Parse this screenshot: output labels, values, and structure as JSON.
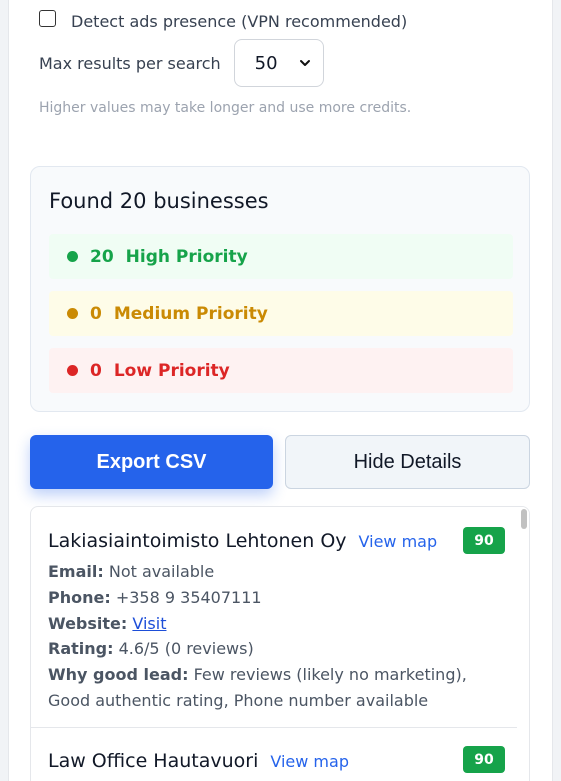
{
  "settings": {
    "detect_ads_label": "Detect ads presence (VPN recommended)",
    "detect_ads_checked": false,
    "max_results_label": "Max results per search",
    "max_results_value": "50",
    "hint": "Higher values may take longer and use more credits."
  },
  "summary": {
    "title": "Found 20 businesses",
    "high": {
      "count": "20",
      "label": "High Priority",
      "color": "#16a34a"
    },
    "medium": {
      "count": "0",
      "label": "Medium Priority",
      "color": "#ca8a04"
    },
    "low": {
      "count": "0",
      "label": "Low Priority",
      "color": "#dc2626"
    }
  },
  "actions": {
    "export_label": "Export CSV",
    "hide_label": "Hide Details"
  },
  "results": [
    {
      "name": "Lakiasiaintoimisto Lehtonen Oy",
      "view_map": "View map",
      "score": "90",
      "email_label": "Email:",
      "email": "Not available",
      "phone_label": "Phone:",
      "phone": "+358 9 35407111",
      "website_label": "Website:",
      "website_link": "Visit",
      "rating_label": "Rating:",
      "rating": "4.6/5 (0 reviews)",
      "why_label": "Why good lead:",
      "why_line1": "Few reviews (likely no marketing),",
      "why_line2": "Good authentic rating, Phone number available"
    },
    {
      "name": "Law Office Hautavuori",
      "view_map": "View map",
      "score": "90"
    }
  ]
}
